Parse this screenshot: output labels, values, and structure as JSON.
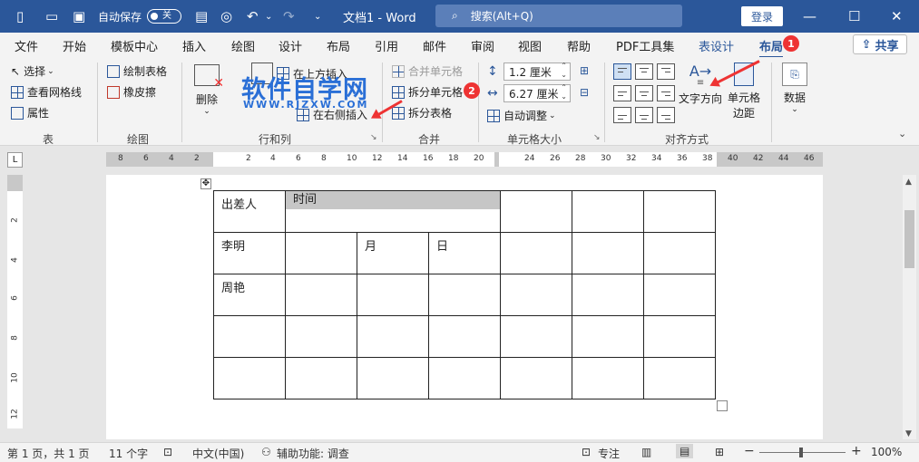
{
  "titlebar": {
    "autosave_label": "自动保存",
    "autosave_state": "关",
    "doc_title": "文档1 - Word",
    "search_placeholder": "搜索(Alt+Q)",
    "login_label": "登录"
  },
  "tabs": [
    "文件",
    "开始",
    "模板中心",
    "插入",
    "绘图",
    "设计",
    "布局",
    "引用",
    "邮件",
    "审阅",
    "视图",
    "帮助",
    "PDF工具集",
    "表设计",
    "布局"
  ],
  "active_tab": "布局",
  "share_label": "共享",
  "ribbon": {
    "table_group": {
      "label": "表",
      "select": "选择",
      "gridlines": "查看网格线",
      "properties": "属性"
    },
    "draw_group": {
      "label": "绘图",
      "draw_table": "绘制表格",
      "eraser": "橡皮擦"
    },
    "rows_cols_group": {
      "label": "行和列",
      "delete": "删除",
      "insert_above": "在上方插入",
      "insert_right": "在右侧插入"
    },
    "merge_group": {
      "label": "合并",
      "merge_cells": "合并单元格",
      "split_cells": "拆分单元格",
      "split_table": "拆分表格"
    },
    "cell_size_group": {
      "label": "单元格大小",
      "height": "1.2 厘米",
      "width": "6.27 厘米",
      "autofit": "自动调整"
    },
    "alignment_group": {
      "label": "对齐方式",
      "text_direction": "文字方向",
      "cell_margins_1": "单元格",
      "cell_margins_2": "边距"
    },
    "data_group": {
      "label": "数据"
    }
  },
  "watermark": {
    "main": "软件自学网",
    "sub": "WWW.RJZXW.COM"
  },
  "badges": [
    "1",
    "2"
  ],
  "ruler_h": [
    "8",
    "6",
    "4",
    "2",
    "2",
    "4",
    "6",
    "8",
    "10",
    "12",
    "14",
    "16",
    "18",
    "20",
    "24",
    "26",
    "28",
    "30",
    "32",
    "34",
    "36",
    "38",
    "40",
    "42",
    "44",
    "46"
  ],
  "ruler_v": [
    "2",
    "4",
    "6",
    "8",
    "10",
    "12"
  ],
  "table": {
    "rows": [
      [
        "出差人",
        "时间",
        "",
        "",
        "",
        "",
        ""
      ],
      [
        "李明",
        "",
        "月",
        "日",
        "",
        "",
        ""
      ],
      [
        "周艳",
        "",
        "",
        "",
        "",
        "",
        ""
      ],
      [
        "",
        "",
        "",
        "",
        "",
        "",
        ""
      ],
      [
        "",
        "",
        "",
        "",
        "",
        "",
        ""
      ]
    ]
  },
  "statusbar": {
    "page": "第 1 页，共 1 页",
    "words": "11 个字",
    "language": "中文(中国)",
    "accessibility": "辅助功能: 调查",
    "focus": "专注",
    "zoom": "100%"
  }
}
